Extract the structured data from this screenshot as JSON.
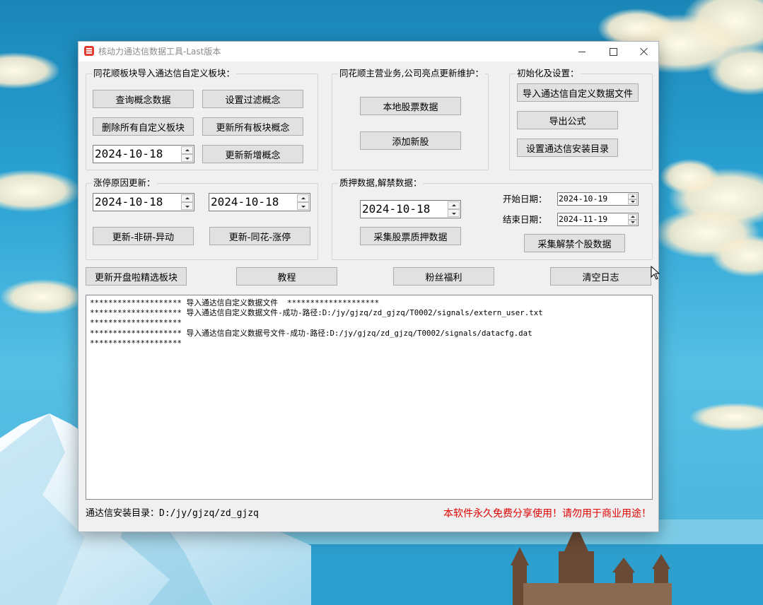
{
  "window": {
    "title": "核动力通达信数据工具-Last版本"
  },
  "ths_import": {
    "label": "同花顺板块导入通达信自定义板块：",
    "query_concepts": "查询概念数据",
    "set_filter": "设置过滤概念",
    "delete_custom": "删除所有自定义板块",
    "update_all": "更新所有板块概念",
    "date": "2024-10-18",
    "update_new": "更新新增概念"
  },
  "ths_business": {
    "label": "同花顺主营业务,公司亮点更新维护：",
    "local_stock_data": "本地股票数据",
    "add_new_stock": "添加新股"
  },
  "settings": {
    "label": "初始化及设置：",
    "import_tdx_custom": "导入通达信自定义数据文件",
    "export_formula": "导出公式",
    "set_tdx_dir": "设置通达信安装目录"
  },
  "limit_up": {
    "label": "涨停原因更新：",
    "date_from": "2024-10-18",
    "date_to": "2024-10-18",
    "update_jiuyan": "更新-非研-异动",
    "update_ths": "更新-同花-涨停"
  },
  "pledge": {
    "label": "质押数据,解禁数据：",
    "date": "2024-10-18",
    "collect_pledge": "采集股票质押数据",
    "start_label": "开始日期：",
    "start_date": "2024-10-19",
    "end_label": "结束日期：",
    "end_date": "2024-11-19",
    "collect_unlock": "采集解禁个股数据"
  },
  "toolbar": {
    "update_kpl": "更新开盘啦精选板块",
    "tutorial": "教程",
    "fan_benefits": "粉丝福利",
    "clear_log": "清空日志"
  },
  "log": {
    "lines": [
      "******************** 导入通达信自定义数据文件  ********************",
      "******************** 导入通达信自定义数据文件-成功-路径:D:/jy/gjzq/zd_gjzq/T0002/signals/extern_user.txt",
      "********************",
      "******************** 导入通达信自定义数据号文件-成功-路径:D:/jy/gjzq/zd_gjzq/T0002/signals/datacfg.dat",
      "********************"
    ]
  },
  "footer": {
    "install_dir": "通达信安装目录：D:/jy/gjzq/zd_gjzq",
    "notice": "本软件永久免费分享使用！请勿用于商业用途！"
  },
  "colors": {
    "notice": "#e00000",
    "app_icon": "#e03c31",
    "window_bg": "#f0f0f0",
    "button_bg": "#e1e1e1"
  },
  "icons": {
    "app": "app-logo-icon",
    "minimize": "minimize-icon",
    "maximize": "maximize-icon",
    "close": "close-icon",
    "spinner_up": "spin-up-icon",
    "spinner_down": "spin-down-icon",
    "cursor": "mouse-cursor-icon"
  }
}
